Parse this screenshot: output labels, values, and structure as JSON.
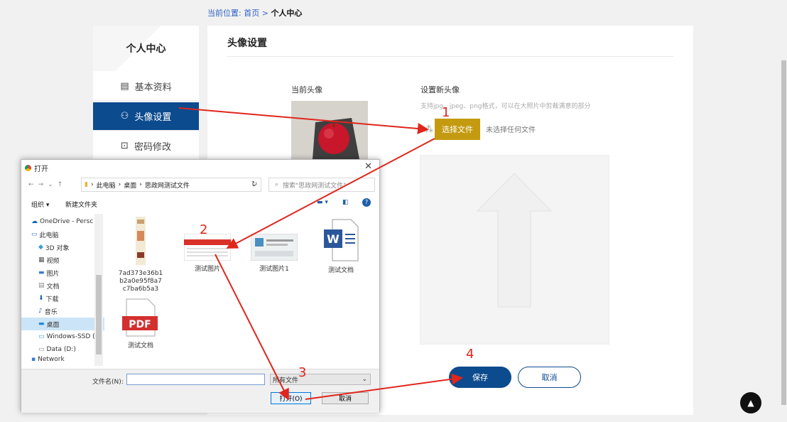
{
  "breadcrumb": {
    "prefix": "当前位置:",
    "home": "首页",
    "sep": ">",
    "current": "个人中心"
  },
  "sidebar": {
    "title": "个人中心",
    "items": [
      {
        "label": "基本资料",
        "icon": "profile-icon"
      },
      {
        "label": "头像设置",
        "icon": "user-icon"
      },
      {
        "label": "密码修改",
        "icon": "lock-icon"
      }
    ]
  },
  "main": {
    "title": "头像设置",
    "current_label": "当前头像",
    "new_label": "设置新头像",
    "hint": "支持jpg、jpeg、png格式，可以在大照片中剪裁满意的部分",
    "choose_btn": "选择文件",
    "no_file": "未选择任何文件",
    "save": "保存",
    "cancel": "取消"
  },
  "dialog": {
    "title": "打开",
    "path": [
      "此电脑",
      "桌面",
      "思政网测试文件"
    ],
    "search_placeholder": "搜索\"思政网测试文件\"",
    "organize": "组织 ▾",
    "new_folder": "新建文件夹",
    "tree": [
      "OneDrive - Persc",
      "此电脑",
      "3D 对象",
      "视频",
      "图片",
      "文档",
      "下载",
      "音乐",
      "桌面",
      "Windows-SSD (",
      "Data (D:)",
      "Network"
    ],
    "files": [
      {
        "name": "7ad373e36b1b2a0e95f8a7c7ba6b5a3"
      },
      {
        "name": "测试图片"
      },
      {
        "name": "测试图片1"
      },
      {
        "name": "测试文档"
      },
      {
        "name": "测试文档"
      }
    ],
    "filename_label": "文件名(N):",
    "filetype": "所有文件",
    "open": "打开(O)",
    "cancel": "取消"
  },
  "annotations": [
    "1",
    "2",
    "3",
    "4"
  ],
  "colors": {
    "primary": "#0c4b8e",
    "choose": "#c49a10",
    "arrow": "#e0261c"
  }
}
